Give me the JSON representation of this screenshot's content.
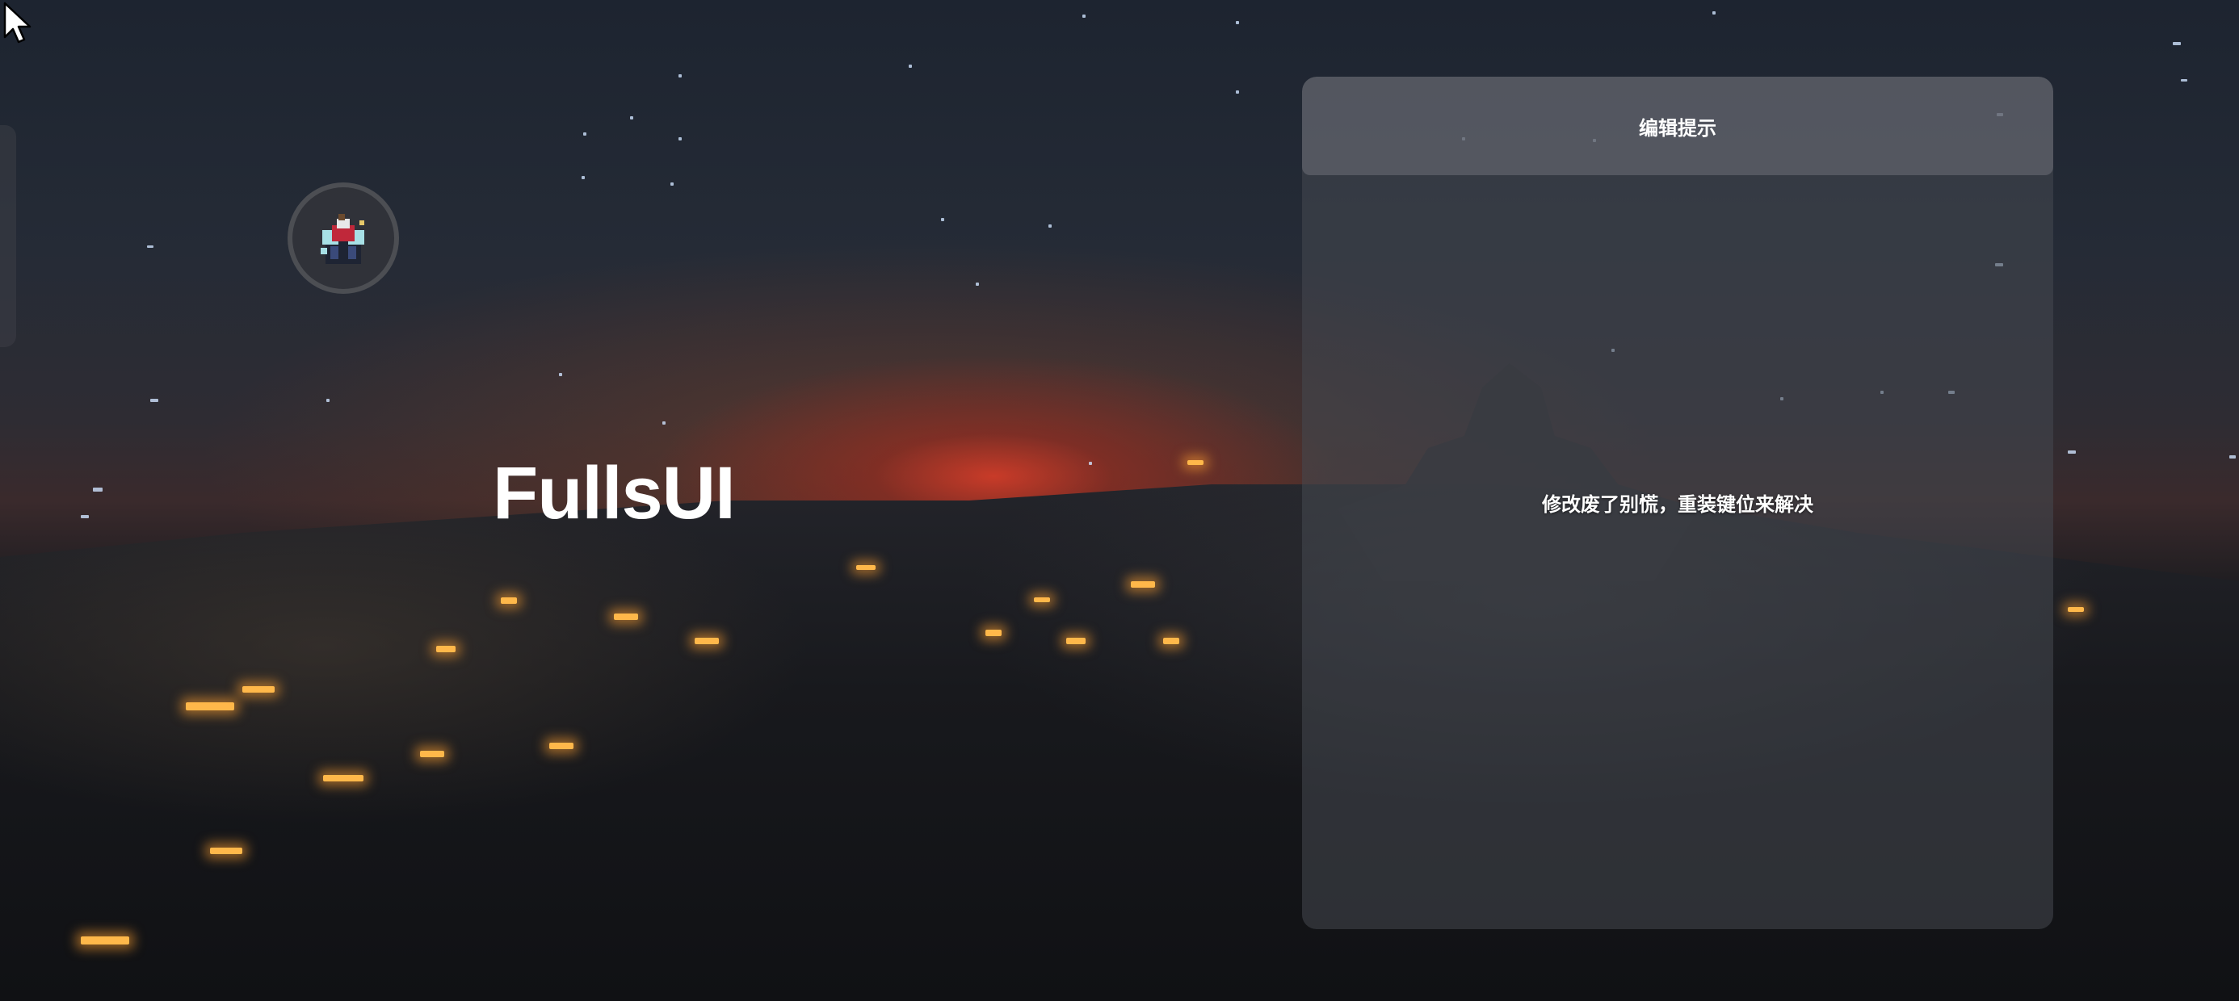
{
  "app": {
    "title": "FullsUI"
  },
  "avatar": {
    "icon": "block-character-avatar-icon"
  },
  "panel": {
    "title": "编辑提示",
    "message": "修改废了别慌，重装键位来解决"
  },
  "colors": {
    "panel_bg": "#46485066",
    "header_bg": "#6e707866",
    "text": "#ffffff",
    "sunset": "#dc3c28",
    "lights": "#ffb84a"
  }
}
